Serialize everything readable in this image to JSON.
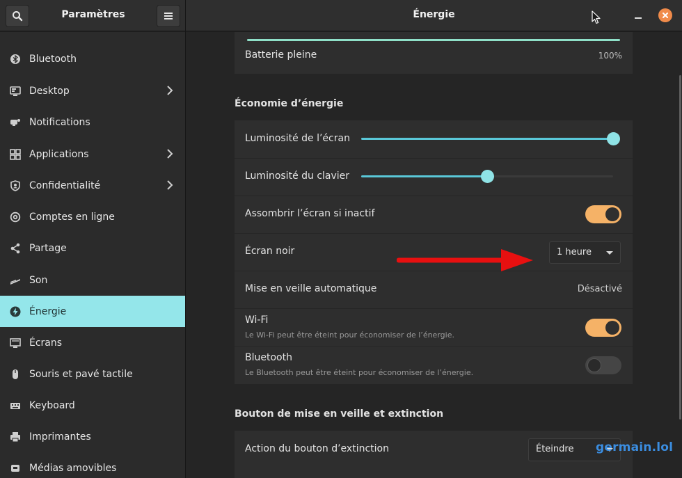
{
  "header": {
    "sidebar_title": "Paramètres",
    "window_title": "Énergie"
  },
  "sidebar": {
    "items": [
      {
        "label": "Bluetooth",
        "icon": "bluetooth-icon"
      },
      {
        "label": "Desktop",
        "icon": "desktop-icon",
        "chevron": true
      },
      {
        "label": "Notifications",
        "icon": "notifications-icon"
      },
      {
        "label": "Applications",
        "icon": "applications-icon",
        "chevron": true
      },
      {
        "label": "Confidentialité",
        "icon": "privacy-icon",
        "chevron": true
      },
      {
        "label": "Comptes en ligne",
        "icon": "online-accounts-icon"
      },
      {
        "label": "Partage",
        "icon": "share-icon"
      },
      {
        "label": "Son",
        "icon": "sound-icon"
      },
      {
        "label": "Énergie",
        "icon": "power-icon",
        "active": true
      },
      {
        "label": "Écrans",
        "icon": "displays-icon"
      },
      {
        "label": "Souris et pavé tactile",
        "icon": "mouse-icon"
      },
      {
        "label": "Keyboard",
        "icon": "keyboard-icon"
      },
      {
        "label": "Imprimantes",
        "icon": "printer-icon"
      },
      {
        "label": "Médias amovibles",
        "icon": "removable-media-icon"
      }
    ]
  },
  "battery": {
    "label": "Batterie pleine",
    "value": "100%",
    "level": 1.0
  },
  "power_saving": {
    "title": "Économie d’énergie",
    "screen_brightness": {
      "label": "Luminosité de l’écran",
      "level": 1.0
    },
    "keyboard_brightness": {
      "label": "Luminosité du clavier",
      "level": 0.5
    },
    "dim_screen": {
      "label": "Assombrir l’écran si inactif",
      "on": true
    },
    "blank_screen": {
      "label": "Écran noir",
      "value": "1 heure"
    },
    "auto_suspend": {
      "label": "Mise en veille automatique",
      "value": "Désactivé"
    },
    "wifi": {
      "label": "Wi-Fi",
      "sublabel": "Le Wi-Fi peut être éteint pour économiser de l’énergie.",
      "on": true
    },
    "bluetooth": {
      "label": "Bluetooth",
      "sublabel": "Le Bluetooth peut être éteint pour économiser de l’énergie.",
      "on": false
    }
  },
  "suspend_button": {
    "title": "Bouton de mise en veille et extinction",
    "power_button_action": {
      "label": "Action du bouton d’extinction",
      "value": "Éteindre"
    }
  },
  "watermark": "germain.lol",
  "colors": {
    "accent": "#94e6ea",
    "toggle_on": "#f5b267",
    "slider": "#5ac8d8",
    "close": "#f08b4a",
    "arrow": "#e81010"
  }
}
